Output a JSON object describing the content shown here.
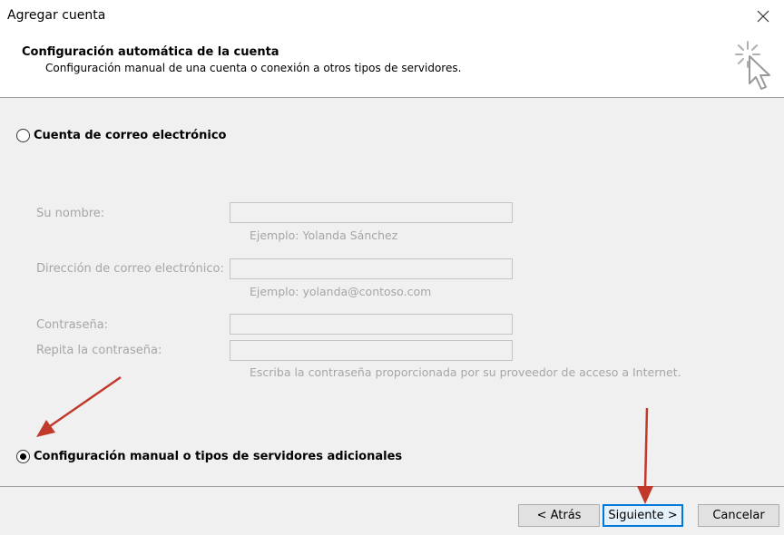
{
  "window": {
    "title": "Agregar cuenta"
  },
  "header": {
    "title": "Configuración automática de la cuenta",
    "subtitle": "Configuración manual de una cuenta o conexión a otros tipos de servidores."
  },
  "options": {
    "email_account_label": "Cuenta de correo electrónico",
    "manual_config_label": "Configuración manual o tipos de servidores adicionales",
    "selected": "manual_config"
  },
  "form": {
    "name_label": "Su nombre:",
    "name_hint": "Ejemplo: Yolanda Sánchez",
    "email_label": "Dirección de correo electrónico:",
    "email_hint": "Ejemplo: yolanda@contoso.com",
    "password_label": "Contraseña:",
    "repeat_password_label": "Repita la contraseña:",
    "password_hint": "Escriba la contraseña proporcionada por su proveedor de acceso a Internet."
  },
  "buttons": {
    "back": "< Atrás",
    "next": "Siguiente >",
    "cancel": "Cancelar"
  },
  "colors": {
    "annotation_arrow": "#c0392b",
    "focus_border": "#0078d7",
    "disabled_text": "#a6a6a6"
  },
  "icons": {
    "close": "close-icon",
    "header": "cursor-click-icon"
  }
}
